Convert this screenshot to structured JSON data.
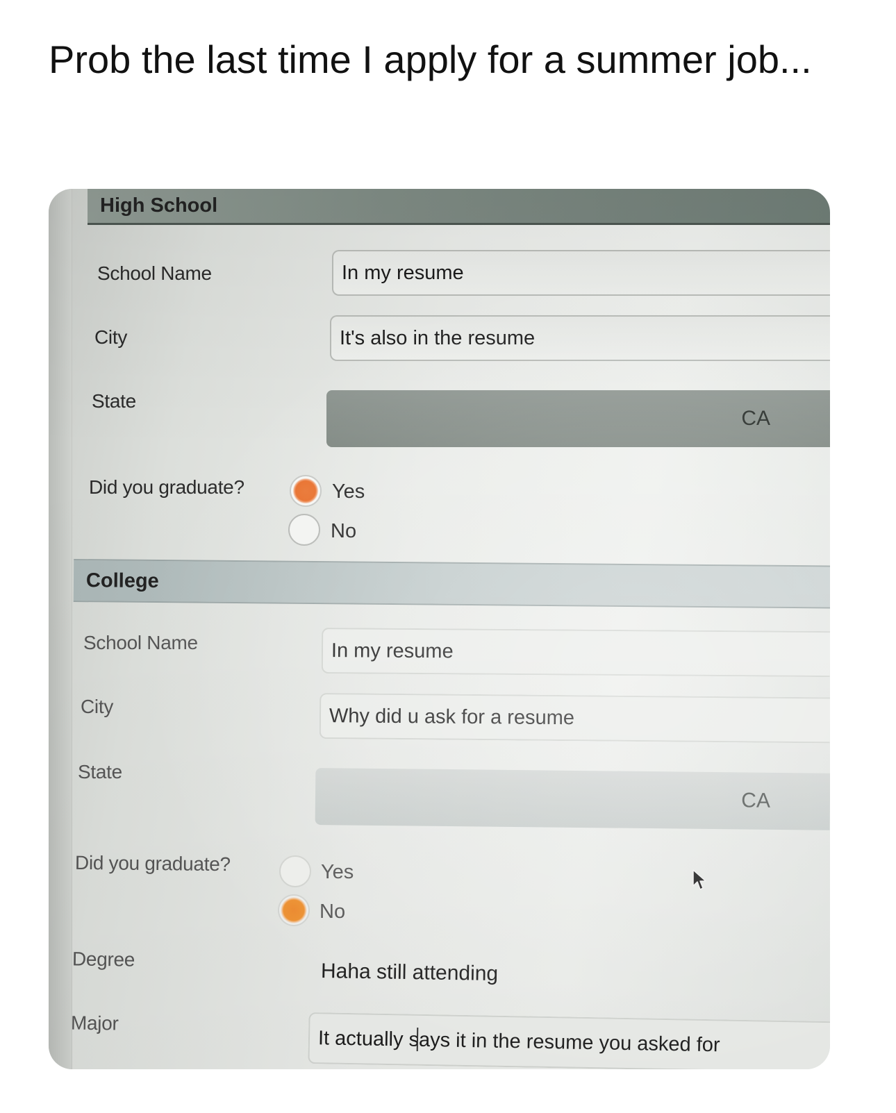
{
  "caption": "Prob the last time I apply for a summer job...",
  "high_school": {
    "header": "High School",
    "school_name": {
      "label": "School Name",
      "value": "In my resume"
    },
    "city": {
      "label": "City",
      "value": "It's also in the resume"
    },
    "state": {
      "label": "State",
      "value": "CA"
    },
    "graduated": {
      "label": "Did you graduate?",
      "yes": "Yes",
      "no": "No",
      "selected": "Yes"
    }
  },
  "college": {
    "header": "College",
    "school_name": {
      "label": "School Name",
      "value": "In my resume"
    },
    "city": {
      "label": "City",
      "value": "Why did u ask for a resume"
    },
    "state": {
      "label": "State",
      "value": "CA"
    },
    "graduated": {
      "label": "Did you graduate?",
      "yes": "Yes",
      "no": "No",
      "selected": "No"
    },
    "degree": {
      "label": "Degree",
      "value": "Haha still attending"
    },
    "major": {
      "label": "Major",
      "value": "It actually says it in the resume you asked for"
    }
  },
  "colors": {
    "radio_selected": "#e86d28",
    "section_header": "#7f8b84"
  },
  "icons": [
    "mouse-pointer-icon"
  ]
}
